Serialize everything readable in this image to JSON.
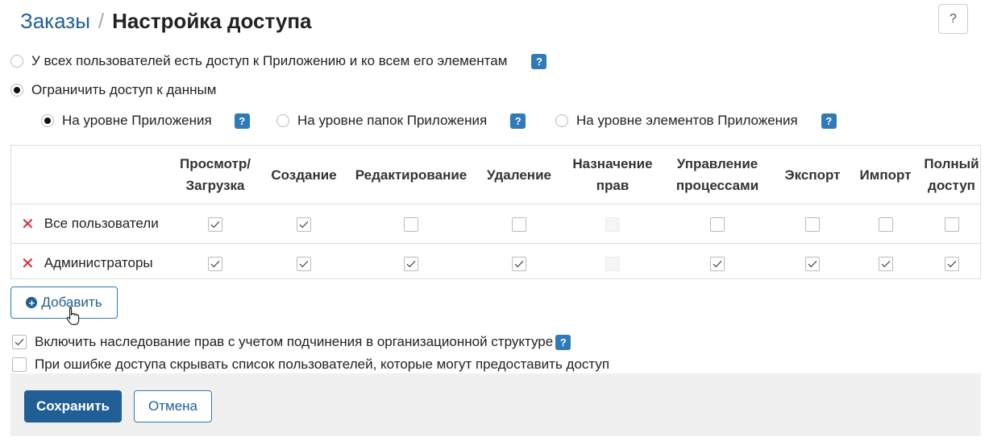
{
  "header": {
    "breadcrumb_link": "Заказы",
    "separator": "/",
    "title": "Настройка доступа",
    "help_icon": "?"
  },
  "access_mode": {
    "options": [
      {
        "label": "У всех пользователей есть доступ к Приложению и ко всем его элементам",
        "selected": false,
        "help": "?"
      },
      {
        "label": "Ограничить доступ к данным",
        "selected": true
      }
    ]
  },
  "level": {
    "options": [
      {
        "label": "На уровне Приложения",
        "selected": true,
        "help": "?"
      },
      {
        "label": "На уровне папок Приложения",
        "selected": false,
        "help": "?"
      },
      {
        "label": "На уровне элементов Приложения",
        "selected": false,
        "help": "?"
      }
    ]
  },
  "permissions": {
    "columns": [
      {
        "line1": "Просмотр/",
        "line2": "Загрузка"
      },
      {
        "line1": "Создание",
        "line2": ""
      },
      {
        "line1": "Редактирование",
        "line2": ""
      },
      {
        "line1": "Удаление",
        "line2": ""
      },
      {
        "line1": "Назначение",
        "line2": "прав"
      },
      {
        "line1": "Управление",
        "line2": "процессами"
      },
      {
        "line1": "Экспорт",
        "line2": ""
      },
      {
        "line1": "Импорт",
        "line2": ""
      },
      {
        "line1": "Полный",
        "line2": "доступ"
      }
    ],
    "rows": [
      {
        "name": "Все пользователи",
        "delete_icon": "✕",
        "cells": [
          "checked",
          "checked",
          "unchecked",
          "unchecked",
          "disabled",
          "unchecked",
          "unchecked",
          "unchecked",
          "unchecked"
        ]
      },
      {
        "name": "Администраторы",
        "delete_icon": "✕",
        "cells": [
          "checked",
          "checked",
          "checked",
          "checked",
          "disabled",
          "checked",
          "checked",
          "checked",
          "checked"
        ]
      }
    ]
  },
  "add_button": {
    "label": "Добавить",
    "icon": "+"
  },
  "options": {
    "inheritance": {
      "label": "Включить наследование прав с учетом подчинения в организационной структуре",
      "checked": true,
      "help": "?"
    },
    "hide_users": {
      "label": "При ошибке доступа  скрывать список пользователей, которые могут предоставить доступ",
      "checked": false
    }
  },
  "footer": {
    "save_label": "Сохранить",
    "cancel_label": "Отмена"
  }
}
